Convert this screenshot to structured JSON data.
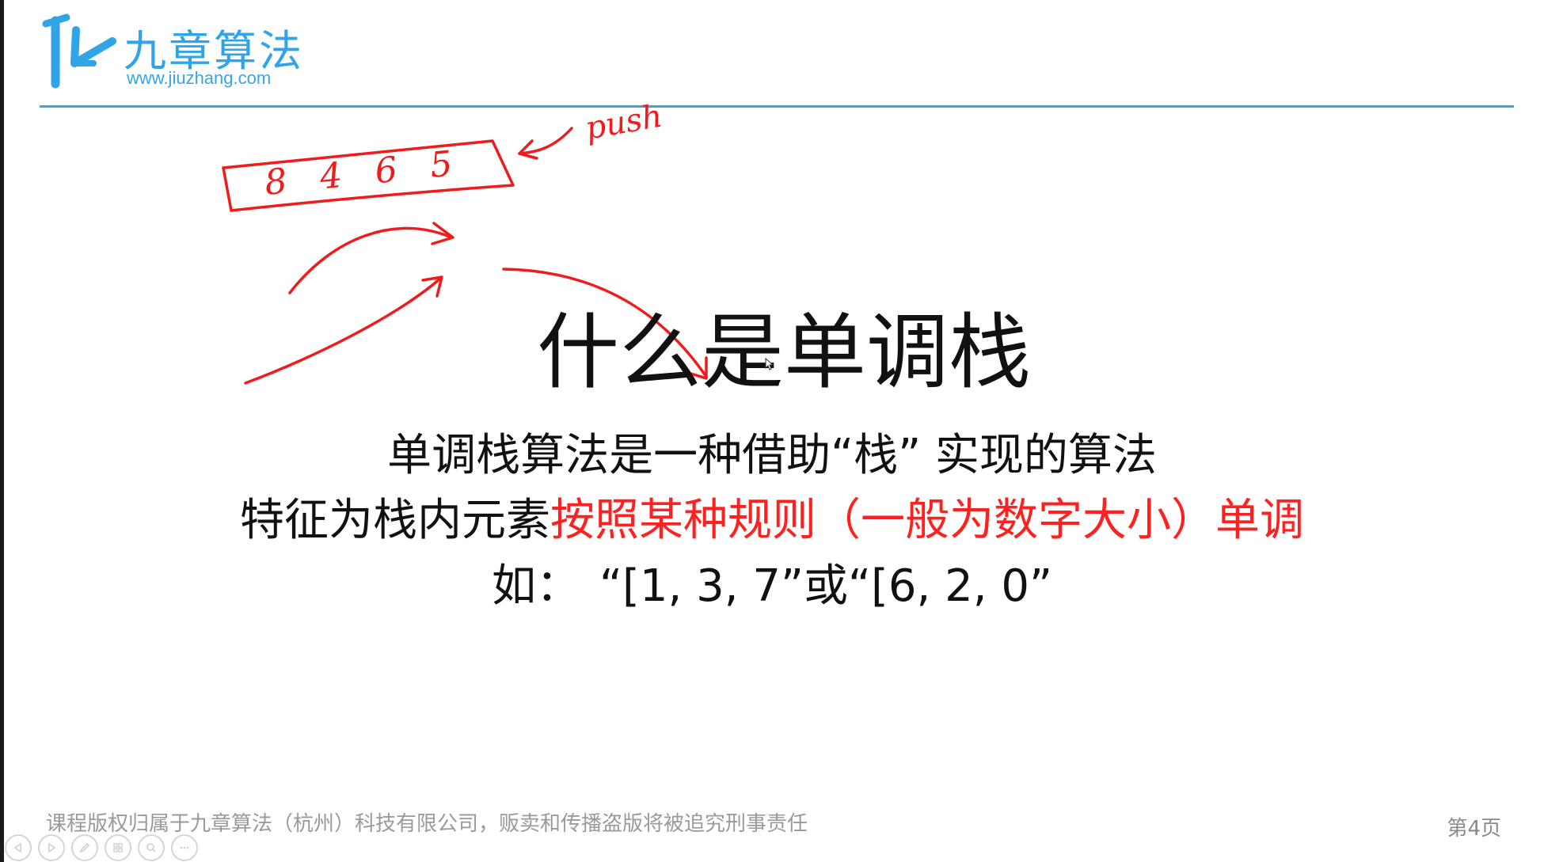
{
  "brand": {
    "name": "九章算法",
    "url": "www.jiuzhang.com",
    "color": "#2fa4e7"
  },
  "annotation": {
    "push_label": "push",
    "stack_contents": "8 4 6 5",
    "ink_color": "#ee1c1c"
  },
  "slide": {
    "title": "什么是单调栈",
    "line1": "单调栈算法是一种借助“栈” 实现的算法",
    "line2_plain": "特征为栈内元素",
    "line2_highlight": "按照某种规则（一般为数字大小）单调",
    "line3_prefix": "如：",
    "line3_example1": "“[1, 3, 7”",
    "line3_or": "或",
    "line3_example2": "“[6, 2, 0”",
    "highlight_color": "#ff2020"
  },
  "footer": {
    "copyright": "课程版权归属于九章算法（杭州）科技有限公司，贩卖和传播盗版将被追究刑事责任",
    "page": "第4页"
  },
  "controls": [
    {
      "name": "previous-slide",
      "icon": "triangle-left-icon"
    },
    {
      "name": "next-slide",
      "icon": "triangle-right-icon"
    },
    {
      "name": "pen",
      "icon": "pen-icon"
    },
    {
      "name": "slide-grid",
      "icon": "grid-icon"
    },
    {
      "name": "zoom",
      "icon": "magnifier-icon"
    },
    {
      "name": "more",
      "icon": "ellipsis-icon"
    }
  ]
}
